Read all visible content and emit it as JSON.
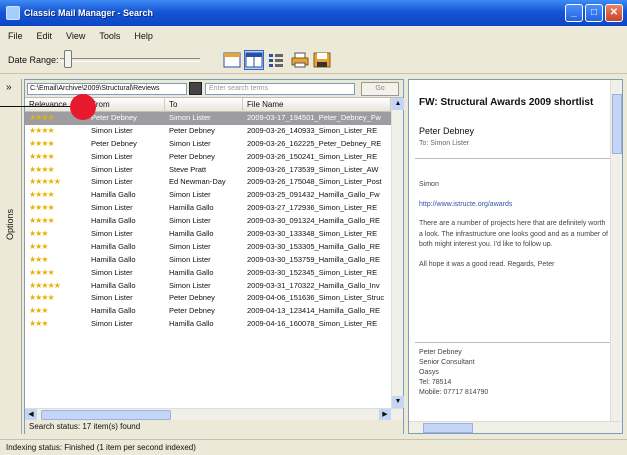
{
  "window": {
    "title": "Classic Mail Manager - Search",
    "buttons": {
      "minimize": "_",
      "maximize": "□",
      "close": "✕"
    }
  },
  "menu": [
    "File",
    "Edit",
    "View",
    "Tools",
    "Help"
  ],
  "toolbar": {
    "date_range_label": "Date Range:",
    "icons": [
      "layout-one-icon",
      "layout-two-icon",
      "columns-icon",
      "print-icon",
      "save-icon"
    ]
  },
  "sidebar": {
    "label": "Options",
    "chevron": "»"
  },
  "search_bar": {
    "path": "C:\\Email\\Archive\\2009\\Structural\\Reviews",
    "placeholder": "Enter search terms",
    "go_label": "Go"
  },
  "columns": [
    "Relevance",
    "From",
    "To",
    "File Name"
  ],
  "messages": [
    {
      "stars": 4,
      "from": "Peter Debney",
      "to": "Simon Lister",
      "file": "2009-03-17_194501_Peter_Debney_Fw",
      "selected": true
    },
    {
      "stars": 4,
      "from": "Simon Lister",
      "to": "Peter Debney",
      "file": "2009-03-26_140933_Simon_Lister_RE"
    },
    {
      "stars": 4,
      "from": "Peter Debney",
      "to": "Simon Lister",
      "file": "2009-03-26_162225_Peter_Debney_RE"
    },
    {
      "stars": 4,
      "from": "Simon Lister",
      "to": "Peter Debney",
      "file": "2009-03-26_150241_Simon_Lister_RE"
    },
    {
      "stars": 4,
      "from": "Simon Lister",
      "to": "Steve Pratt",
      "file": "2009-03-26_173539_Simon_Lister_AW"
    },
    {
      "stars": 5,
      "from": "Simon Lister",
      "to": "Ed Newman-Day",
      "file": "2009-03-26_175048_Simon_Lister_Post"
    },
    {
      "stars": 4,
      "from": "Hamilla Gallo",
      "to": "Simon Lister",
      "file": "2009-03-25_091432_Hamilla_Gallo_Fw"
    },
    {
      "stars": 4,
      "from": "Simon Lister",
      "to": "Hamilla Gallo",
      "file": "2009-03-27_172936_Simon_Lister_RE"
    },
    {
      "stars": 4,
      "from": "Hamilla Gallo",
      "to": "Simon Lister",
      "file": "2009-03-30_091324_Hamilla_Gallo_RE"
    },
    {
      "stars": 3,
      "from": "Simon Lister",
      "to": "Hamilla Gallo",
      "file": "2009-03-30_133348_Simon_Lister_RE"
    },
    {
      "stars": 3,
      "from": "Hamilla Gallo",
      "to": "Simon Lister",
      "file": "2009-03-30_153305_Hamilla_Gallo_RE"
    },
    {
      "stars": 3,
      "from": "Hamilla Gallo",
      "to": "Simon Lister",
      "file": "2009-03-30_153759_Hamilla_Gallo_RE"
    },
    {
      "stars": 4,
      "from": "Simon Lister",
      "to": "Hamilla Gallo",
      "file": "2009-03-30_152345_Simon_Lister_RE"
    },
    {
      "stars": 5,
      "from": "Hamilla Gallo",
      "to": "Simon Lister",
      "file": "2009-03-31_170322_Hamilla_Gallo_Inv"
    },
    {
      "stars": 4,
      "from": "Simon Lister",
      "to": "Peter Debney",
      "file": "2009-04-06_151636_Simon_Lister_Struc"
    },
    {
      "stars": 3,
      "from": "Hamilla Gallo",
      "to": "Peter Debney",
      "file": "2009-04-13_123414_Hamilla_Gallo_RE"
    },
    {
      "stars": 3,
      "from": "Simon Lister",
      "to": "Hamilla Gallo",
      "file": "2009-04-16_160078_Simon_Lister_RE"
    }
  ],
  "pane_status": "Search status: 17 item(s) found",
  "preview": {
    "subject": "FW: Structural Awards 2009 shortlist",
    "from": "Peter Debney",
    "to": "To: Simon Lister",
    "body": [
      "Simon",
      "http://www.istructe.org/awards",
      "There are a number of projects here that are definitely worth a look. The infrastructure one looks good and as a number of both might interest you. I'd like to follow up.",
      "All hope it was a good read. Regards, Peter"
    ],
    "signature": [
      "Peter Debney",
      "Senior Consultant",
      "Oasys",
      "Tel: 78514",
      "Mobile: 07717 814790"
    ]
  },
  "statusbar": "Indexing status: Finished (1 item per second indexed)"
}
